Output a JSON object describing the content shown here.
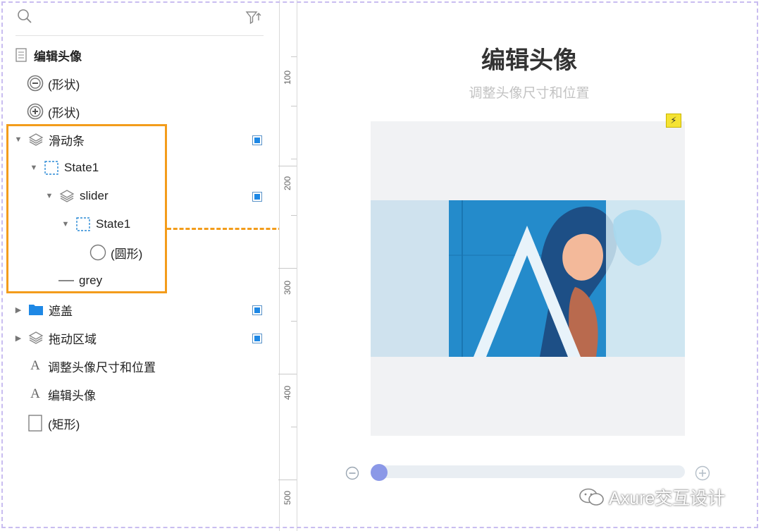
{
  "outline": {
    "items": [
      {
        "label": "编辑头像"
      },
      {
        "label": "(形状)"
      },
      {
        "label": "(形状)"
      },
      {
        "label": "滑动条"
      },
      {
        "label": "State1"
      },
      {
        "label": "slider"
      },
      {
        "label": "State1"
      },
      {
        "label": "(圆形)"
      },
      {
        "label": "grey"
      },
      {
        "label": "遮盖"
      },
      {
        "label": "拖动区域"
      },
      {
        "label": "调整头像尺寸和位置"
      },
      {
        "label": "编辑头像"
      },
      {
        "label": "(矩形)"
      }
    ]
  },
  "ruler": {
    "labels": [
      "100",
      "200",
      "300",
      "400",
      "500"
    ]
  },
  "canvas": {
    "title": "编辑头像",
    "subtitle": "调整头像尺寸和位置",
    "slider_value": 0
  },
  "watermark": "Axure交互设计",
  "colors": {
    "highlight": "#f39c1b",
    "knob": "#8b98e7",
    "frame": "#c9bdf0"
  }
}
